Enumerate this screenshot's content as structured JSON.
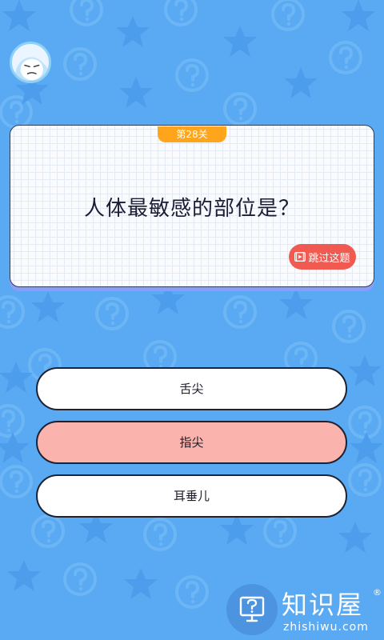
{
  "colors": {
    "background": "#5aa9f3",
    "level_tag": "#ffa51c",
    "skip_button": "#f05a51",
    "selected_option": "#fbb3ad",
    "card_shadow": "#8c9cf8"
  },
  "player": {
    "avatar_icon": "sleepy-face-icon"
  },
  "level": {
    "label": "第28关"
  },
  "question": {
    "text": "人体最敏感的部位是？"
  },
  "skip": {
    "label": "跳过这题",
    "icon": "video-icon"
  },
  "options": [
    {
      "label": "舌尖",
      "selected": false
    },
    {
      "label": "指尖",
      "selected": true
    },
    {
      "label": "耳垂儿",
      "selected": false
    }
  ],
  "watermark": {
    "title": "知识屋",
    "registered": "®",
    "url": "zhishiwu.com",
    "icon": "monitor-question-icon"
  }
}
